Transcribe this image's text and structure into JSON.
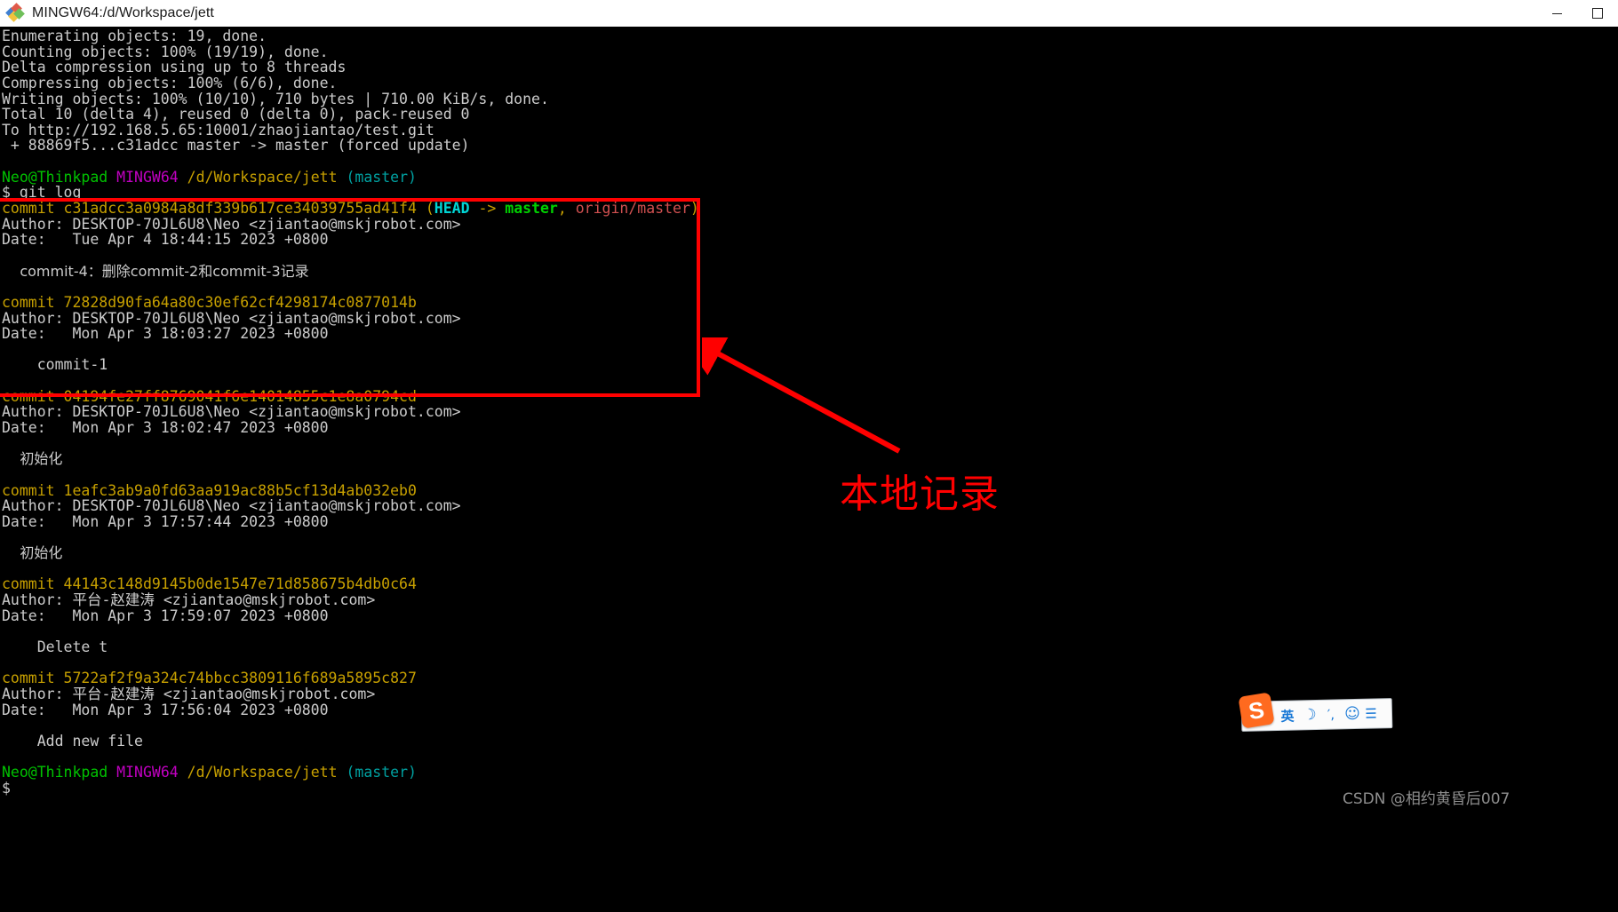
{
  "window": {
    "title": "MINGW64:/d/Workspace/jett",
    "icon": "git-bash-icon",
    "minimize_label": "–",
    "maximize_label": "❐",
    "close_label": "✕"
  },
  "colors": {
    "background": "#000000",
    "foreground": "#cccccc",
    "yellow": "#c7a000",
    "green": "#00c200",
    "magenta": "#c000c0",
    "cyan": "#00a0a0",
    "annotation_red": "#ff0000",
    "ime_orange": "#ff6a1f",
    "ime_blue": "#1878d6"
  },
  "terminal": {
    "push_output": [
      "Enumerating objects: 19, done.",
      "Counting objects: 100% (19/19), done.",
      "Delta compression using up to 8 threads",
      "Compressing objects: 100% (6/6), done.",
      "Writing objects: 100% (10/10), 710 bytes | 710.00 KiB/s, done.",
      "Total 10 (delta 4), reused 0 (delta 0), pack-reused 0",
      "To http://192.168.5.65:10001/zhaojiantao/test.git",
      " + 88869f5...c31adcc master -> master (forced update)"
    ],
    "prompt": {
      "user_host": "Neo@Thinkpad",
      "shell": "MINGW64",
      "path": "/d/Workspace/jett",
      "branch": "(master)",
      "sigil": "$"
    },
    "command": "git log",
    "commits": [
      {
        "hash": "c31adcc3a0984a8df339b617ce34039755ad41f4",
        "decoration_open": "(",
        "decoration_head": "HEAD",
        "decoration_arrow": " -> ",
        "decoration_branch": "master",
        "decoration_sep": ", ",
        "decoration_remote": "origin/master",
        "decoration_close": ")",
        "author": "Author: DESKTOP-70JL6U8\\Neo <zjiantao@mskjrobot.com>",
        "date": "Date:   Tue Apr 4 18:44:15 2023 +0800",
        "message": "commit-4：删除commit-2和commit-3记录"
      },
      {
        "hash": "72828d90fa64a80c30ef62cf4298174c0877014b",
        "author": "Author: DESKTOP-70JL6U8\\Neo <zjiantao@mskjrobot.com>",
        "date": "Date:   Mon Apr 3 18:03:27 2023 +0800",
        "message": "commit-1"
      },
      {
        "hash": "04194fe27ff8769041f6e14014855c1e8a0794cd",
        "author": "Author: DESKTOP-70JL6U8\\Neo <zjiantao@mskjrobot.com>",
        "date": "Date:   Mon Apr 3 18:02:47 2023 +0800",
        "message": "初始化"
      },
      {
        "hash": "1eafc3ab9a0fd63aa919ac88b5cf13d4ab032eb0",
        "author": "Author: DESKTOP-70JL6U8\\Neo <zjiantao@mskjrobot.com>",
        "date": "Date:   Mon Apr 3 17:57:44 2023 +0800",
        "message": "初始化"
      },
      {
        "hash": "44143c148d9145b0de1547e71d858675b4db0c64",
        "author": "Author: 平台-赵建涛 <zjiantao@mskjrobot.com>",
        "date": "Date:   Mon Apr 3 17:59:07 2023 +0800",
        "message": "Delete t"
      },
      {
        "hash": "5722af2f9a324c74bbcc3809116f689a5895c827",
        "author": "Author: 平台-赵建涛 <zjiantao@mskjrobot.com>",
        "date": "Date:   Mon Apr 3 17:56:04 2023 +0800",
        "message": "Add new file"
      }
    ],
    "commit_keyword": "commit ",
    "final_prompt_sigil": "$"
  },
  "annotation": {
    "label": "本地记录",
    "box_name": "highlighted-commits-box",
    "arrow_name": "red-arrow"
  },
  "ime": {
    "logo_text": "S",
    "mode": "英",
    "moon": "☽",
    "punctuation": "′,",
    "face": "☺",
    "more": "☰"
  },
  "watermark": "CSDN @相约黄昏后007"
}
